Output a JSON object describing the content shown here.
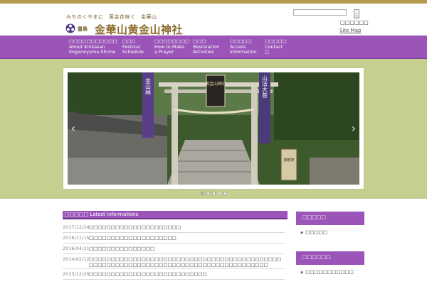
{
  "header": {
    "tagline": "みちのくやまに　黄金花咲く　金華山",
    "logo_small": "霊島",
    "site_title": "金華山黄金山神社",
    "language_link": "□□□□□□",
    "sitemap_link": "Site Map"
  },
  "nav": {
    "items": [
      {
        "line1": "□□□□□□□□□□□",
        "line2": "About Kinkasan",
        "line3": "Koganeyama Shrine"
      },
      {
        "line1": "□□□",
        "line2": "Festival",
        "line3": "Schedule"
      },
      {
        "line1": "□□□□□□□□",
        "line2": "How to Make",
        "line3": "a Prayer"
      },
      {
        "line1": "□□□",
        "line2": "Restoration",
        "line3": "Activities"
      },
      {
        "line1": "□□□□□",
        "line2": "Access",
        "line3": "Information"
      },
      {
        "line1": "□□□□□",
        "line2": "Contact",
        "line3": "□"
      }
    ]
  },
  "slider": {
    "prev_symbol": "‹",
    "next_symbol": "›",
    "banner_left": "金山林",
    "banner_right": "山法大菩",
    "gate_plaque": "黄金山神社",
    "sign_text": "御祭神"
  },
  "news": {
    "heading": "□□□□□ Latest Informations",
    "items": [
      {
        "date": "2017/12/24",
        "title": "□□□□□□□□□□□□□□□□□□□□□"
      },
      {
        "date": "2016/11/15",
        "title": "□□□□□□□□□□□□□□□□□□□□"
      },
      {
        "date": "2016/04/21",
        "title": "□□□□□□□□□□□□□□□"
      },
      {
        "date": "2014/02/12",
        "title": "□□□□□□□□□□□□□□□□□□□□□□□□□□□□□□□□□□□□□□□□□□□□□□□□□□□□□□□□□□□□□□□□□□□□□□□□□□□□□□□□□□□□□"
      },
      {
        "date": "2013/12/26",
        "title": "□□□□□□□□□□□□□□□□□□□□□□□□□□□"
      }
    ]
  },
  "sidebar": {
    "boxes": [
      {
        "heading": "□□□□□",
        "item": "□□□□□"
      },
      {
        "heading": "□□□□□□",
        "item": "□□□□□□□□□□□"
      }
    ]
  },
  "colors": {
    "accent_purple": "#9b55b8",
    "gold": "#b49a4c",
    "slider_band": "#c6cf90"
  }
}
